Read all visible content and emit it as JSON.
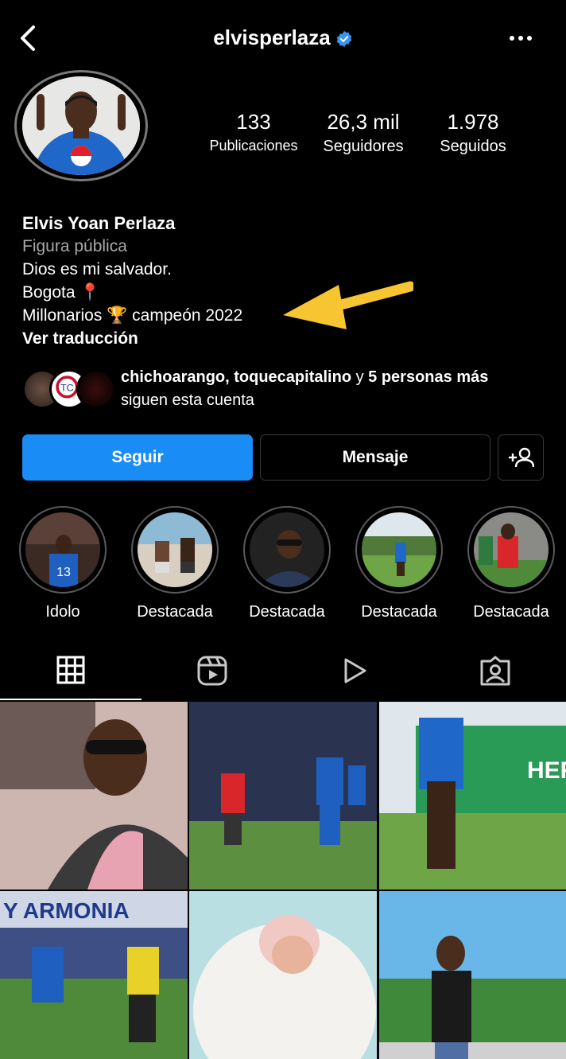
{
  "header": {
    "username": "elvisperlaza",
    "verified": true,
    "icons": [
      "back-arrow-icon",
      "verified-badge-icon",
      "more-options-icon"
    ]
  },
  "stats": {
    "posts": {
      "value": "133",
      "label": "Publicaciones"
    },
    "followers": {
      "value": "26,3 mil",
      "label": "Seguidores"
    },
    "following": {
      "value": "1.978",
      "label": "Seguidos"
    }
  },
  "bio": {
    "name": "Elvis Yoan Perlaza",
    "category": "Figura pública",
    "line1": "Dios es mi salvador.",
    "line2": "Bogota 📍",
    "line3": "Millonarios 🏆 campeón 2022",
    "translate": "Ver traducción"
  },
  "followed_by": {
    "names": "chichoarango, toquecapitalino",
    "joiner": " y ",
    "others": "5 personas más",
    "suffix": "siguen esta cuenta"
  },
  "buttons": {
    "follow": "Seguir",
    "message": "Mensaje"
  },
  "highlights": [
    {
      "label": "Idolo"
    },
    {
      "label": "Destacada"
    },
    {
      "label": "Destacada"
    },
    {
      "label": "Destacada"
    },
    {
      "label": "Destacada"
    }
  ],
  "tabs": [
    "grid-icon",
    "reels-icon",
    "video-play-icon",
    "tagged-icon"
  ],
  "colors": {
    "accent_blue": "#1a8cf5",
    "arrow_yellow": "#f7c531",
    "background": "#000000"
  }
}
